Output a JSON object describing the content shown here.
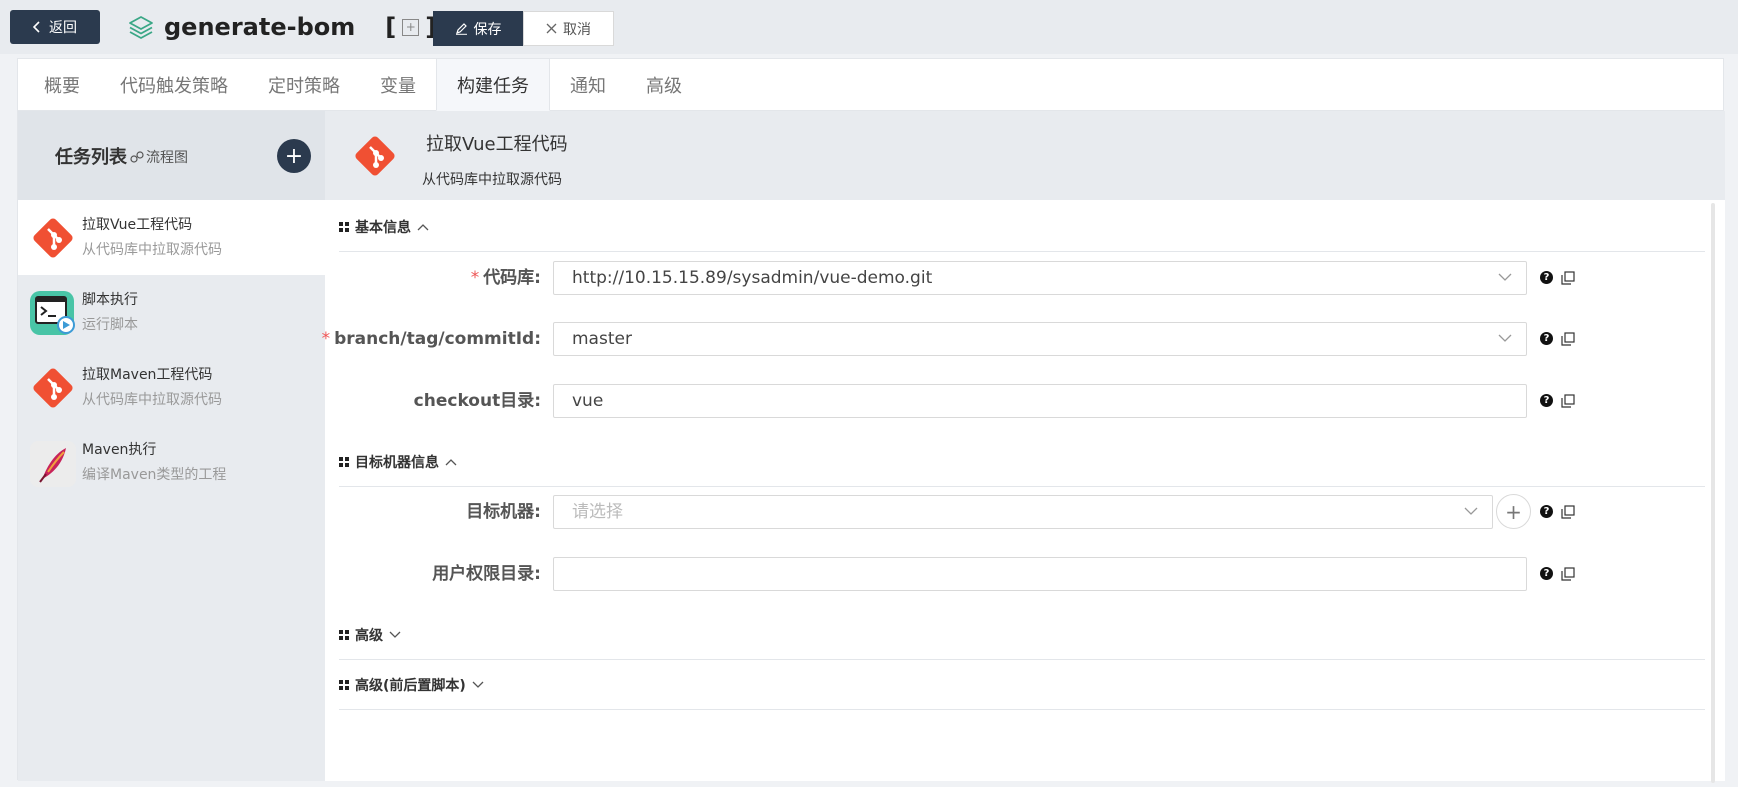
{
  "header": {
    "back_label": "返回",
    "title": "generate-bom",
    "bracket_open": "[",
    "bracket_close": "]",
    "plus_glyph": "+",
    "save_label": "保存",
    "cancel_label": "取消"
  },
  "tabs": [
    {
      "label": "概要"
    },
    {
      "label": "代码触发策略"
    },
    {
      "label": "定时策略"
    },
    {
      "label": "变量"
    },
    {
      "label": "构建任务",
      "active": true
    },
    {
      "label": "通知"
    },
    {
      "label": "高级"
    }
  ],
  "sidebar": {
    "title": "任务列表",
    "flow_link": "流程图",
    "add_glyph": "+",
    "tasks": [
      {
        "name": "拉取Vue工程代码",
        "desc": "从代码库中拉取源代码",
        "icon": "git-icon",
        "active": true
      },
      {
        "name": "脚本执行",
        "desc": "运行脚本",
        "icon": "terminal-icon"
      },
      {
        "name": "拉取Maven工程代码",
        "desc": "从代码库中拉取源代码",
        "icon": "git-icon"
      },
      {
        "name": "Maven执行",
        "desc": "编译Maven类型的工程",
        "icon": "maven-feather-icon"
      }
    ]
  },
  "detail": {
    "title": "拉取Vue工程代码",
    "desc": "从代码库中拉取源代码",
    "sections": {
      "basic": "基本信息",
      "target": "目标机器信息",
      "advanced": "高级",
      "advanced_scripts": "高级(前后置脚本)"
    },
    "fields": {
      "repo_label": "代码库:",
      "repo_value": "http://10.15.15.89/sysadmin/vue-demo.git",
      "branch_label": "branch/tag/commitId:",
      "branch_value": "master",
      "checkout_label": "checkout目录:",
      "checkout_value": "vue",
      "machine_label": "目标机器:",
      "machine_placeholder": "请选择",
      "perm_label": "用户权限目录:",
      "perm_value": "",
      "required_mark": "*",
      "help_glyph": "?",
      "add_glyph": "+"
    }
  },
  "colors": {
    "dark_navy": "#2b3a4e",
    "git_orange": "#f05033",
    "teal_layers": "#3aa786",
    "required_red": "#e55555"
  }
}
